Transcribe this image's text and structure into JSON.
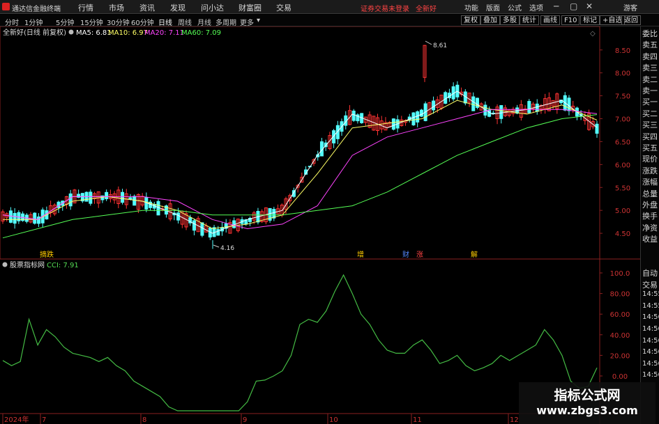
{
  "app": {
    "title": "通达信金融终端"
  },
  "menu": {
    "items": [
      "行情",
      "市场",
      "资讯",
      "发现",
      "问小达",
      "财富圈",
      "交易"
    ]
  },
  "notice": "证券交易未登录",
  "stock_name_top": "全新好",
  "right_menu": [
    "功能",
    "版面",
    "公式",
    "选项",
    "游客"
  ],
  "periods": [
    "分时",
    "1分钟",
    "5分钟",
    "15分钟",
    "30分钟",
    "60分钟",
    "日线",
    "周线",
    "月线",
    "多周期",
    "更多"
  ],
  "active_period": "日线",
  "toolbar_right": [
    "复权",
    "叠加",
    "多股",
    "统计",
    "画线",
    "F10",
    "标记",
    "+自选",
    "返回"
  ],
  "main_chart": {
    "header": "全新好(日线 前复权)",
    "ma": [
      {
        "label": "MA5: 6.81",
        "color": "#ffffff"
      },
      {
        "label": "MA10: 6.97",
        "color": "#ffff66"
      },
      {
        "label": "MA20: 7.11",
        "color": "#ff44ff"
      },
      {
        "label": "MA60: 7.09",
        "color": "#55ff55"
      }
    ],
    "high_label": "8.61",
    "low_label": "4.16",
    "events": [
      {
        "text": "摘",
        "color": "#ffcc00"
      },
      {
        "text": "增",
        "color": "#ffcc00"
      },
      {
        "text": "财",
        "color": "#5588ff"
      },
      {
        "text": "涨",
        "color": "#ff4444"
      },
      {
        "text": "解",
        "color": "#ffcc00"
      }
    ],
    "y_ticks": [
      "8.50",
      "8.00",
      "7.50",
      "7.00",
      "6.50",
      "6.00",
      "5.50",
      "5.00",
      "4.50"
    ]
  },
  "indicator": {
    "header": "股票指标网",
    "cci_label": "CCI: 7.91",
    "y_ticks": [
      "100.0",
      "80.00",
      "60.00",
      "40.00",
      "20.00",
      "0.00"
    ]
  },
  "x_axis": [
    "2024年",
    "7",
    "8",
    "9",
    "10",
    "11",
    "12"
  ],
  "sidebar": {
    "top": [
      "委比",
      "卖五",
      "卖四",
      "卖三",
      "卖二",
      "卖一",
      "买一",
      "买二",
      "买三",
      "买四",
      "买五",
      "现价",
      "涨跌",
      "涨幅",
      "总量",
      "外盘",
      "换手",
      "净资",
      "收益"
    ],
    "bottom": [
      "自动",
      "交易",
      "14:55",
      "14:55",
      "14:56",
      "14:56",
      "14:56",
      "14:56",
      "14:56",
      "14:56"
    ]
  },
  "watermark": {
    "line1": "指标公式网",
    "line2": "www.zbgs3.com"
  },
  "colors": {
    "up": "#ff3333",
    "down": "#54ffff",
    "cci": "#44bb44",
    "axis": "#8a2020"
  },
  "chart_data": [
    {
      "type": "candlestick",
      "title": "全新好(日线 前复权)",
      "x": [
        "2024年",
        "7",
        "8",
        "9",
        "10",
        "11",
        "12"
      ],
      "ylim": [
        4.0,
        8.8
      ],
      "high": 8.61,
      "low": 4.16,
      "series": [
        {
          "name": "MA5",
          "values": [
            4.9,
            4.8,
            5.3,
            5.3,
            5.2,
            4.9,
            4.5,
            4.8,
            5.0,
            6.2,
            7.1,
            6.8,
            7.1,
            7.6,
            7.1,
            7.2,
            7.4,
            6.81
          ]
        },
        {
          "name": "MA10",
          "values": [
            4.8,
            4.8,
            5.2,
            5.3,
            5.2,
            5.0,
            4.6,
            4.7,
            4.9,
            5.8,
            6.8,
            6.9,
            7.0,
            7.4,
            7.2,
            7.1,
            7.3,
            6.97
          ]
        },
        {
          "name": "MA20",
          "values": [
            4.9,
            4.8,
            5.3,
            5.3,
            5.3,
            5.2,
            4.8,
            4.6,
            4.7,
            5.1,
            6.2,
            6.6,
            6.8,
            7.0,
            7.2,
            7.2,
            7.2,
            7.11
          ]
        },
        {
          "name": "MA60",
          "values": [
            4.4,
            4.6,
            4.8,
            4.9,
            5.0,
            5.0,
            4.9,
            4.9,
            4.9,
            5.0,
            5.1,
            5.4,
            5.8,
            6.2,
            6.5,
            6.8,
            7.0,
            7.09
          ]
        }
      ]
    },
    {
      "type": "line",
      "title": "CCI",
      "ylim": [
        0,
        100
      ],
      "series": [
        {
          "name": "CCI",
          "values": [
            15,
            10,
            14,
            55,
            30,
            45,
            38,
            28,
            22,
            20,
            18,
            14,
            18,
            10,
            5,
            -5,
            -10,
            -15,
            -20,
            -30,
            -35,
            -40,
            -38,
            -45,
            -48,
            -52,
            -50,
            -40,
            -25,
            -5,
            -4,
            0,
            5,
            20,
            50,
            55,
            52,
            63,
            82,
            98,
            80,
            60,
            50,
            35,
            25,
            22,
            22,
            30,
            35,
            25,
            12,
            15,
            20,
            10,
            5,
            8,
            12,
            20,
            15,
            20,
            25,
            30,
            45,
            35,
            20,
            -5,
            -12,
            -10,
            7.91
          ]
        }
      ]
    }
  ]
}
